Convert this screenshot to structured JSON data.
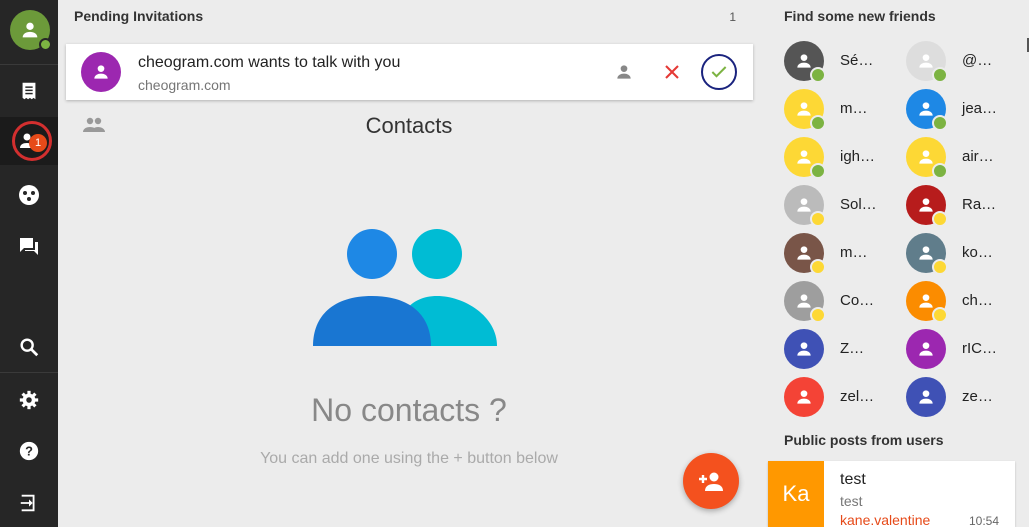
{
  "nav": {
    "items": [
      {
        "name": "roster-icon"
      },
      {
        "name": "contacts-icon",
        "badge": "1"
      },
      {
        "name": "communities-icon"
      },
      {
        "name": "chats-icon"
      },
      {
        "name": "search-icon"
      },
      {
        "name": "settings-icon"
      },
      {
        "name": "help-icon"
      },
      {
        "name": "logout-icon"
      }
    ]
  },
  "pending": {
    "heading": "Pending Invitations",
    "count": "1",
    "invites": [
      {
        "title": "cheogram.com wants to talk with you",
        "subtitle": "cheogram.com",
        "color": "#9c27b0"
      }
    ]
  },
  "contacts": {
    "title": "Contacts",
    "empty_title": "No contacts ?",
    "empty_subtitle": "You can add one using the + button below"
  },
  "friends": {
    "heading": "Find some new friends",
    "items": [
      {
        "name": "Sé…",
        "color": "#555555",
        "status": "#7cb342"
      },
      {
        "name": "@…",
        "color": "#dddddd",
        "status": "#7cb342"
      },
      {
        "name": "m…",
        "color": "#fdd835",
        "status": "#7cb342"
      },
      {
        "name": "jea…",
        "color": "#1e88e5",
        "status": "#7cb342"
      },
      {
        "name": "igh…",
        "color": "#fdd835",
        "status": "#7cb342"
      },
      {
        "name": "air…",
        "color": "#fdd835",
        "status": "#7cb342"
      },
      {
        "name": "Sol…",
        "color": "#bbbbbb",
        "status": "#fdd835"
      },
      {
        "name": "Ra…",
        "color": "#b71c1c",
        "status": "#fdd835"
      },
      {
        "name": "m…",
        "color": "#795548",
        "status": "#fdd835"
      },
      {
        "name": "ko…",
        "color": "#607d8b",
        "status": "#fdd835"
      },
      {
        "name": "Co…",
        "color": "#9e9e9e",
        "status": "#fdd835"
      },
      {
        "name": "ch…",
        "color": "#fb8c00",
        "status": "#fdd835"
      },
      {
        "name": "Z…",
        "color": "#3f51b5",
        "status": ""
      },
      {
        "name": "rIC…",
        "color": "#9c27b0",
        "status": ""
      },
      {
        "name": "zel…",
        "color": "#f44336",
        "status": ""
      },
      {
        "name": "ze…",
        "color": "#3f51b5",
        "status": ""
      }
    ]
  },
  "posts": {
    "heading": "Public posts from users",
    "items": [
      {
        "avatar_text": "Ka",
        "title": "test",
        "body": "test",
        "author": "kane.valentine",
        "time": "10:54"
      }
    ]
  }
}
